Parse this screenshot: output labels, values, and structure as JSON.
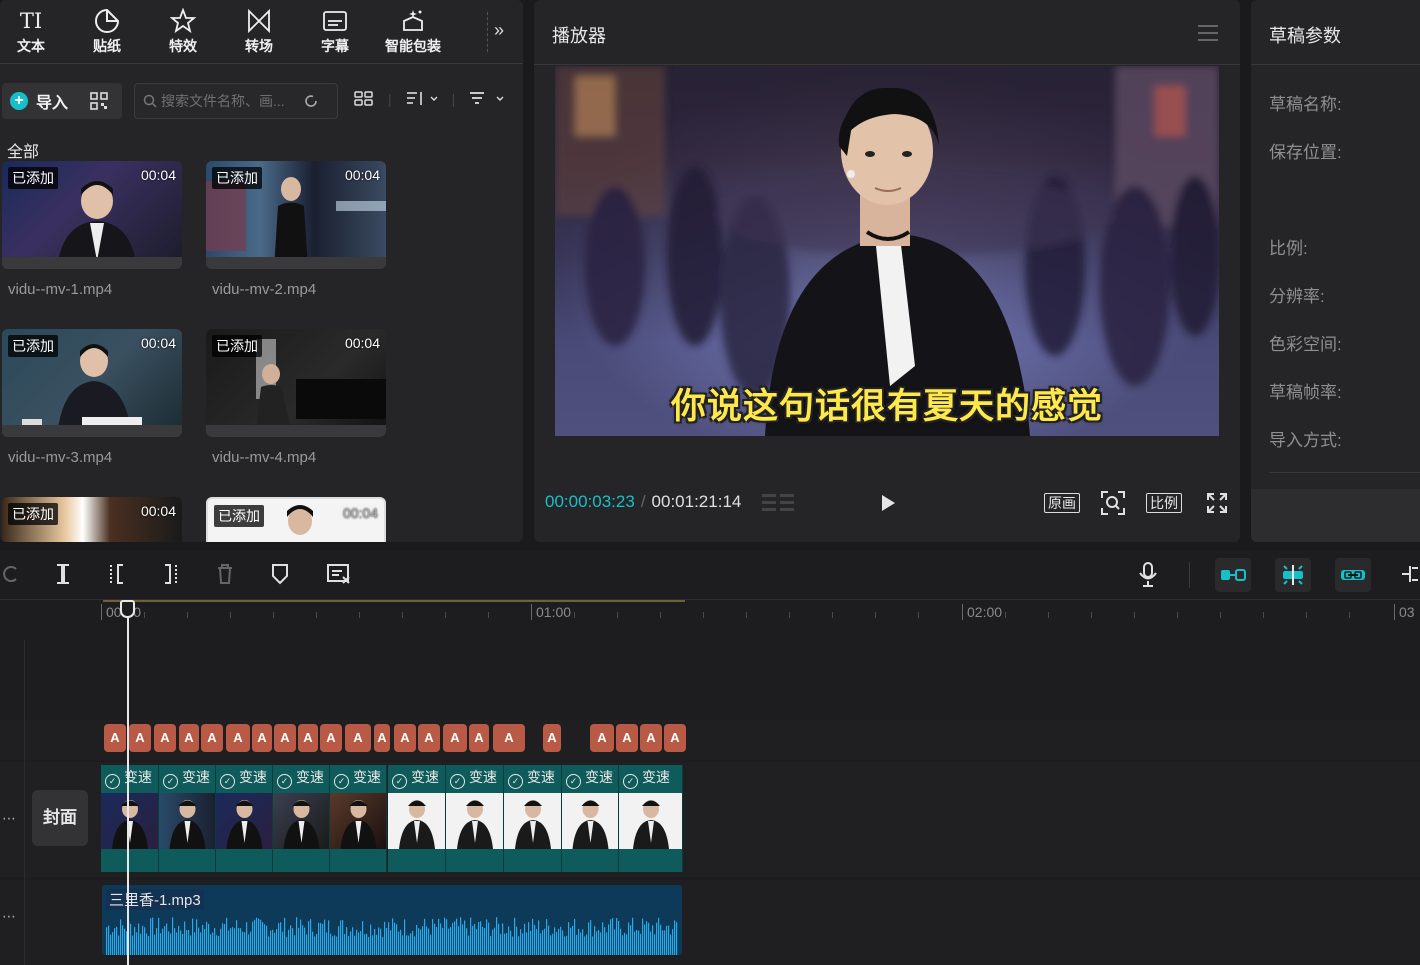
{
  "toolbar": {
    "tools": [
      {
        "label": "文本",
        "icon": "text-icon"
      },
      {
        "label": "贴纸",
        "icon": "sticker-icon"
      },
      {
        "label": "特效",
        "icon": "effects-icon"
      },
      {
        "label": "转场",
        "icon": "transition-icon"
      },
      {
        "label": "字幕",
        "icon": "caption-icon"
      },
      {
        "label": "智能包装",
        "icon": "smart-package-icon"
      }
    ],
    "text_glyph": "TI",
    "more": "»"
  },
  "media": {
    "import_label": "导入",
    "search_placeholder": "搜索文件名称、画...",
    "all_label": "全部",
    "clips": [
      {
        "name": "vidu--mv-1.mp4",
        "tag": "已添加",
        "duration": "00:04"
      },
      {
        "name": "vidu--mv-2.mp4",
        "tag": "已添加",
        "duration": "00:04"
      },
      {
        "name": "vidu--mv-3.mp4",
        "tag": "已添加",
        "duration": "00:04"
      },
      {
        "name": "vidu--mv-4.mp4",
        "tag": "已添加",
        "duration": "00:04"
      },
      {
        "name": "",
        "tag": "已添加",
        "duration": "00:04"
      },
      {
        "name": "",
        "tag": "已添加",
        "duration": "00:04"
      }
    ]
  },
  "player": {
    "title": "播放器",
    "subtitle": "你说这句话很有夏天的感觉",
    "time_current": "00:00:03:23",
    "time_sep": "/",
    "time_total": "00:01:21:14",
    "btn_original": "原画",
    "btn_ratio": "比例"
  },
  "params": {
    "title": "草稿参数",
    "rows": [
      "草稿名称:",
      "保存位置:",
      "比例:",
      "分辨率:",
      "色彩空间:",
      "草稿帧率:",
      "导入方式:"
    ]
  },
  "timeline": {
    "ruler_labels": [
      "00:00",
      "01:00",
      "02:00",
      "03"
    ],
    "text_chip_glyph": "A",
    "speed_label": "变速",
    "cover_label": "封面",
    "audio_name": "三里香-1.mp3"
  },
  "colors": {
    "accent": "#17c0c8",
    "text_clip": "#b85a45",
    "video_clip": "#0f5a5a",
    "audio_clip": "#0e3a5a",
    "subtitle": "#ffe84a"
  }
}
